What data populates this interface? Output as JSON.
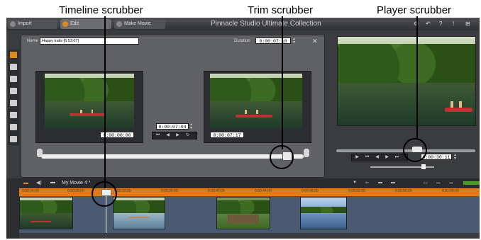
{
  "callouts": {
    "timeline": "Timeline scrubber",
    "trim": "Trim scrubber",
    "player": "Player scrubber"
  },
  "topbar": {
    "tabs": [
      {
        "label": "Import",
        "icon": "import-icon"
      },
      {
        "label": "Edit",
        "icon": "edit-icon"
      },
      {
        "label": "Make Movie",
        "icon": "movie-icon"
      }
    ],
    "title": "Pinnacle Studio Ultimate Collection",
    "icons": [
      "settings-icon",
      "help-icon",
      "zoom-icon"
    ]
  },
  "editor": {
    "name_label": "Name",
    "name_value": "Happy trails [6:53:07]",
    "duration_label": "Duration",
    "duration_value": "0:00:07:18",
    "in_timecode": "0:00:00:00",
    "length_timecode": "0:00:07:04",
    "out_timecode": "0:00:07:17"
  },
  "player": {
    "timecode": "0:00:30:11"
  },
  "timeline": {
    "project_name": "My Movie 4 *",
    "ruler_ticks": [
      "0:00:24:00",
      "0:00:28:00",
      "0:00:32:00",
      "0:00:36:00",
      "0:00:40:00",
      "0:00:44:00",
      "0:00:48:00",
      "0:00:52:00",
      "0:00:56:00",
      "0:01:00:00"
    ]
  },
  "colors": {
    "app_bg": "#3a3c3f",
    "ruler_orange": "#e07b16",
    "track_blue": "#4a5a73",
    "editor_panel": "#5f6165"
  }
}
